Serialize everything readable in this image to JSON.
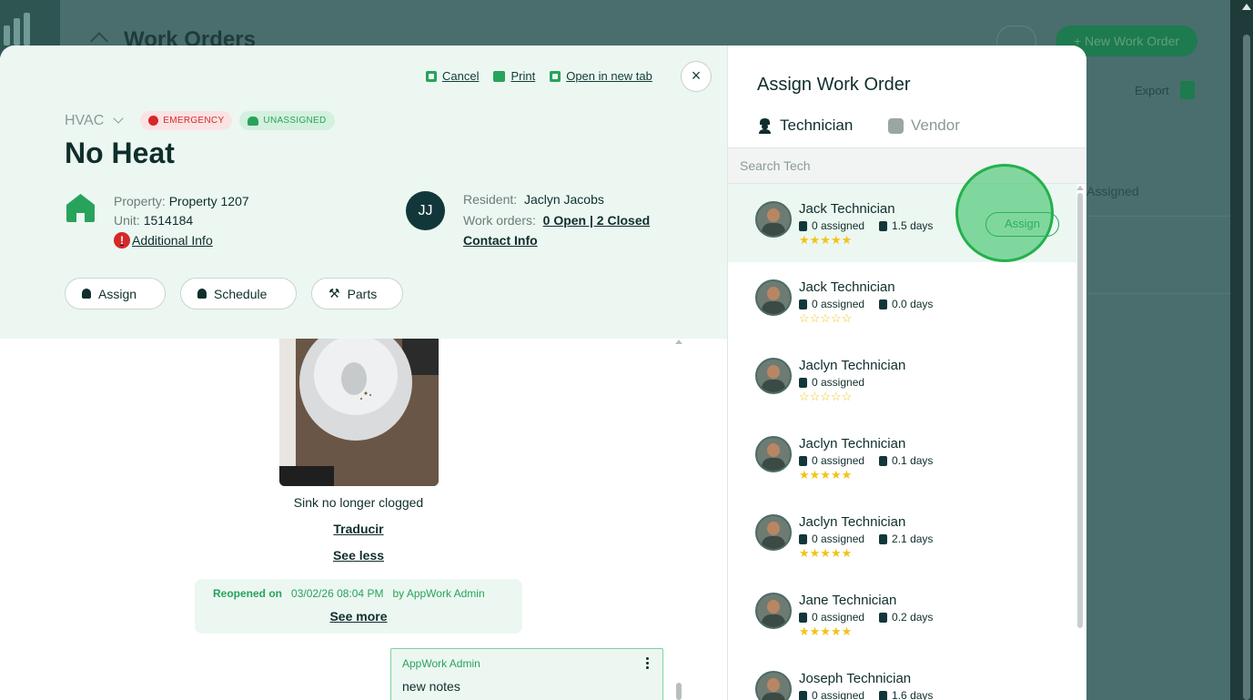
{
  "background": {
    "page_title": "Work Orders",
    "new_button": "+ New Work Order",
    "export_label": "Export",
    "column_label": "Assigned"
  },
  "header": {
    "cancel": "Cancel",
    "print": "Print",
    "open_new_tab": "Open in new tab",
    "close": "×"
  },
  "work_order": {
    "category": "HVAC",
    "priority_badge": "EMERGENCY",
    "assign_badge": "UNASSIGNED",
    "title": "No Heat",
    "property_label": "Property:",
    "property_value": "Property 1207",
    "unit_label": "Unit:",
    "unit_value": "1514184",
    "additional_info": "Additional Info",
    "resident_initials": "JJ",
    "resident_label": "Resident:",
    "resident_name": "Jaclyn Jacobs",
    "work_orders_label": "Work orders:",
    "work_orders_value": "0 Open | 2 Closed",
    "contact_info": "Contact Info"
  },
  "actions": {
    "assign": "Assign",
    "schedule": "Schedule",
    "parts": "Parts"
  },
  "timeline": {
    "photo_caption": "Sink no longer clogged",
    "translate": "Traducir",
    "see_less": "See less",
    "reopened_label": "Reopened on",
    "reopened_date": "03/02/26 08:04 PM",
    "reopened_by": "by AppWork Admin",
    "see_more": "See more",
    "note_author": "AppWork Admin",
    "note_text": "new notes"
  },
  "assign_panel": {
    "title": "Assign Work Order",
    "tab_technician": "Technician",
    "tab_vendor": "Vendor",
    "search_placeholder": "Search Tech",
    "assign_button": "Assign",
    "technicians": [
      {
        "name": "Jack Technician",
        "assigned": "0 assigned",
        "days": "1.5 days",
        "stars": "★★★★★"
      },
      {
        "name": "Jack Technician",
        "assigned": "0 assigned",
        "days": "0.0 days",
        "stars": "☆☆☆☆☆"
      },
      {
        "name": "Jaclyn Technician",
        "assigned": "0 assigned",
        "days": "",
        "stars": "☆☆☆☆☆"
      },
      {
        "name": "Jaclyn Technician",
        "assigned": "0 assigned",
        "days": "0.1 days",
        "stars": "★★★★★"
      },
      {
        "name": "Jaclyn Technician",
        "assigned": "0 assigned",
        "days": "2.1 days",
        "stars": "★★★★★"
      },
      {
        "name": "Jane Technician",
        "assigned": "0 assigned",
        "days": "0.2 days",
        "stars": "★★★★★"
      },
      {
        "name": "Joseph Technician",
        "assigned": "0 assigned",
        "days": "1.6 days",
        "stars": ""
      }
    ]
  },
  "colors": {
    "accent_green": "#28a35c",
    "emergency_red": "#d62828",
    "dark_teal": "#0f2e2c",
    "star_yellow": "#f0c419"
  }
}
